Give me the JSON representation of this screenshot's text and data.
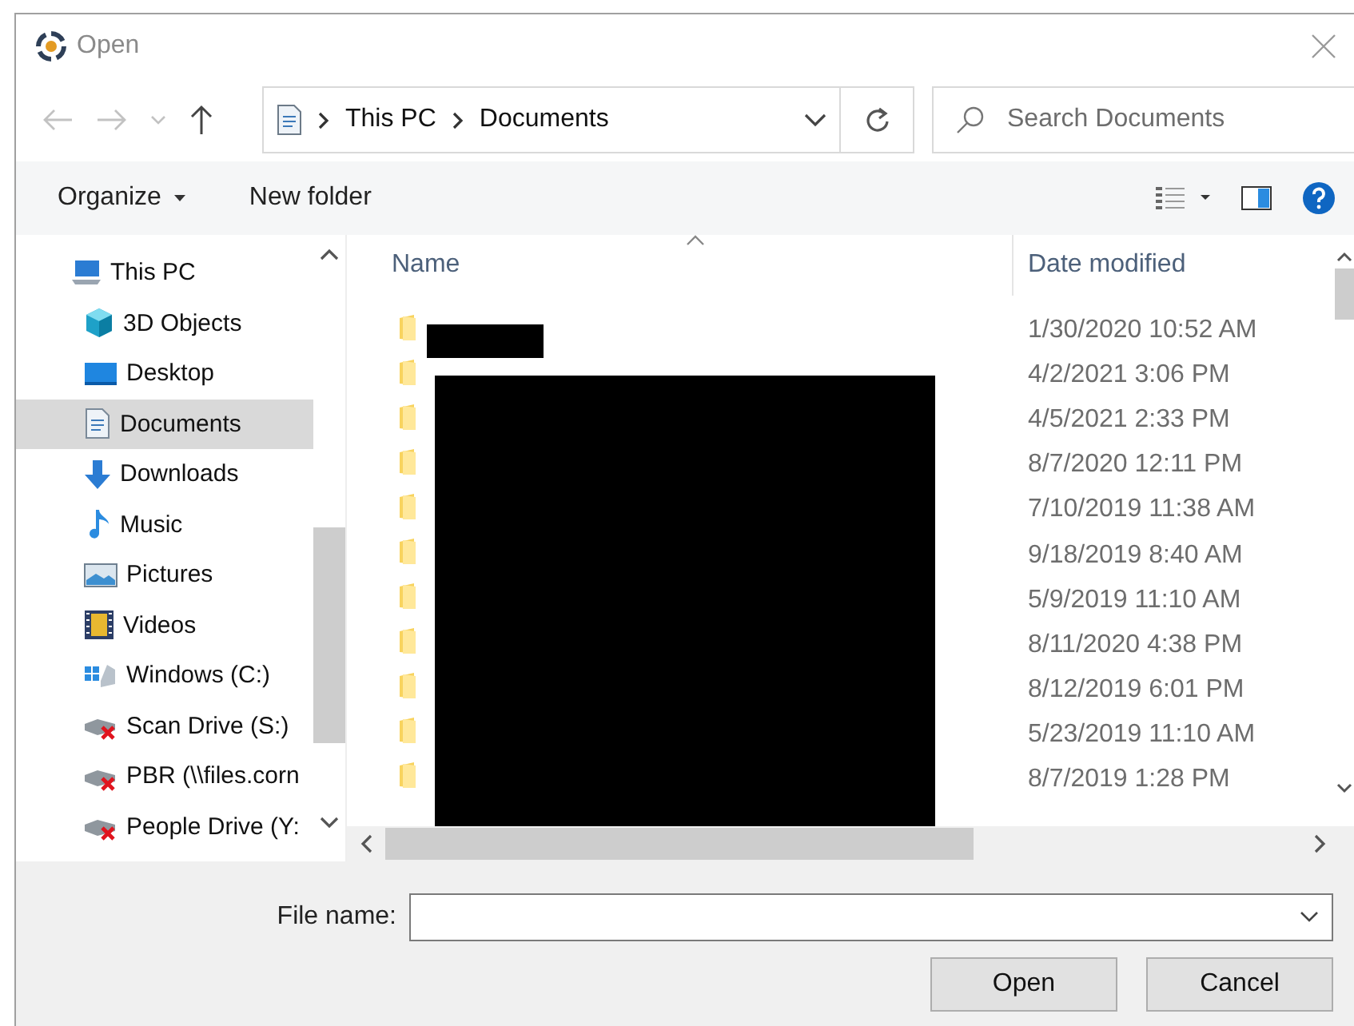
{
  "window": {
    "title": "Open"
  },
  "address": {
    "path": [
      {
        "label": "This PC"
      },
      {
        "label": "Documents"
      }
    ]
  },
  "search": {
    "placeholder": "Search Documents"
  },
  "toolbar": {
    "buttons": [
      {
        "label": "Organize",
        "kind": "menu"
      },
      {
        "label": "New folder",
        "kind": "plain"
      }
    ]
  },
  "sidebar": {
    "items": [
      {
        "label": "This PC",
        "kind": "pc",
        "selected": false,
        "children": [
          {
            "label": "3D Objects",
            "kind": "cube",
            "selected": false
          },
          {
            "label": "Desktop",
            "kind": "desktop",
            "selected": false
          },
          {
            "label": "Documents",
            "kind": "documents",
            "selected": true
          },
          {
            "label": "Downloads",
            "kind": "downloads",
            "selected": false
          },
          {
            "label": "Music",
            "kind": "music",
            "selected": false
          },
          {
            "label": "Pictures",
            "kind": "pictures",
            "selected": false
          },
          {
            "label": "Videos",
            "kind": "videos",
            "selected": false
          },
          {
            "label": "Windows (C:)",
            "kind": "drive",
            "selected": false
          },
          {
            "label": "Scan Drive (S:)",
            "kind": "netdrive",
            "selected": false
          },
          {
            "label": "PBR (\\\\files.corn",
            "kind": "netdrive",
            "selected": false
          },
          {
            "label": "People Drive (Y:",
            "kind": "netdrive",
            "selected": false
          }
        ]
      }
    ]
  },
  "file_list": {
    "columns": [
      {
        "label": "Name",
        "sorted": true
      },
      {
        "label": "Date modified",
        "sorted": false
      }
    ],
    "rows": [
      {
        "date": "1/30/2020 10:52 AM"
      },
      {
        "date": "4/2/2021 3:06 PM"
      },
      {
        "date": "4/5/2021 2:33 PM"
      },
      {
        "date": "8/7/2020 12:11 PM"
      },
      {
        "date": "7/10/2019 11:38 AM"
      },
      {
        "date": "9/18/2019 8:40 AM"
      },
      {
        "date": "5/9/2019 11:10 AM"
      },
      {
        "date": "8/11/2020 4:38 PM"
      },
      {
        "date": "8/12/2019 6:01 PM"
      },
      {
        "date": "5/23/2019 11:10 AM"
      },
      {
        "date": "8/7/2019 1:28 PM"
      }
    ]
  },
  "footer": {
    "file_name": {
      "label": "File name:"
    },
    "buttons": [
      "Open",
      "Cancel"
    ]
  }
}
